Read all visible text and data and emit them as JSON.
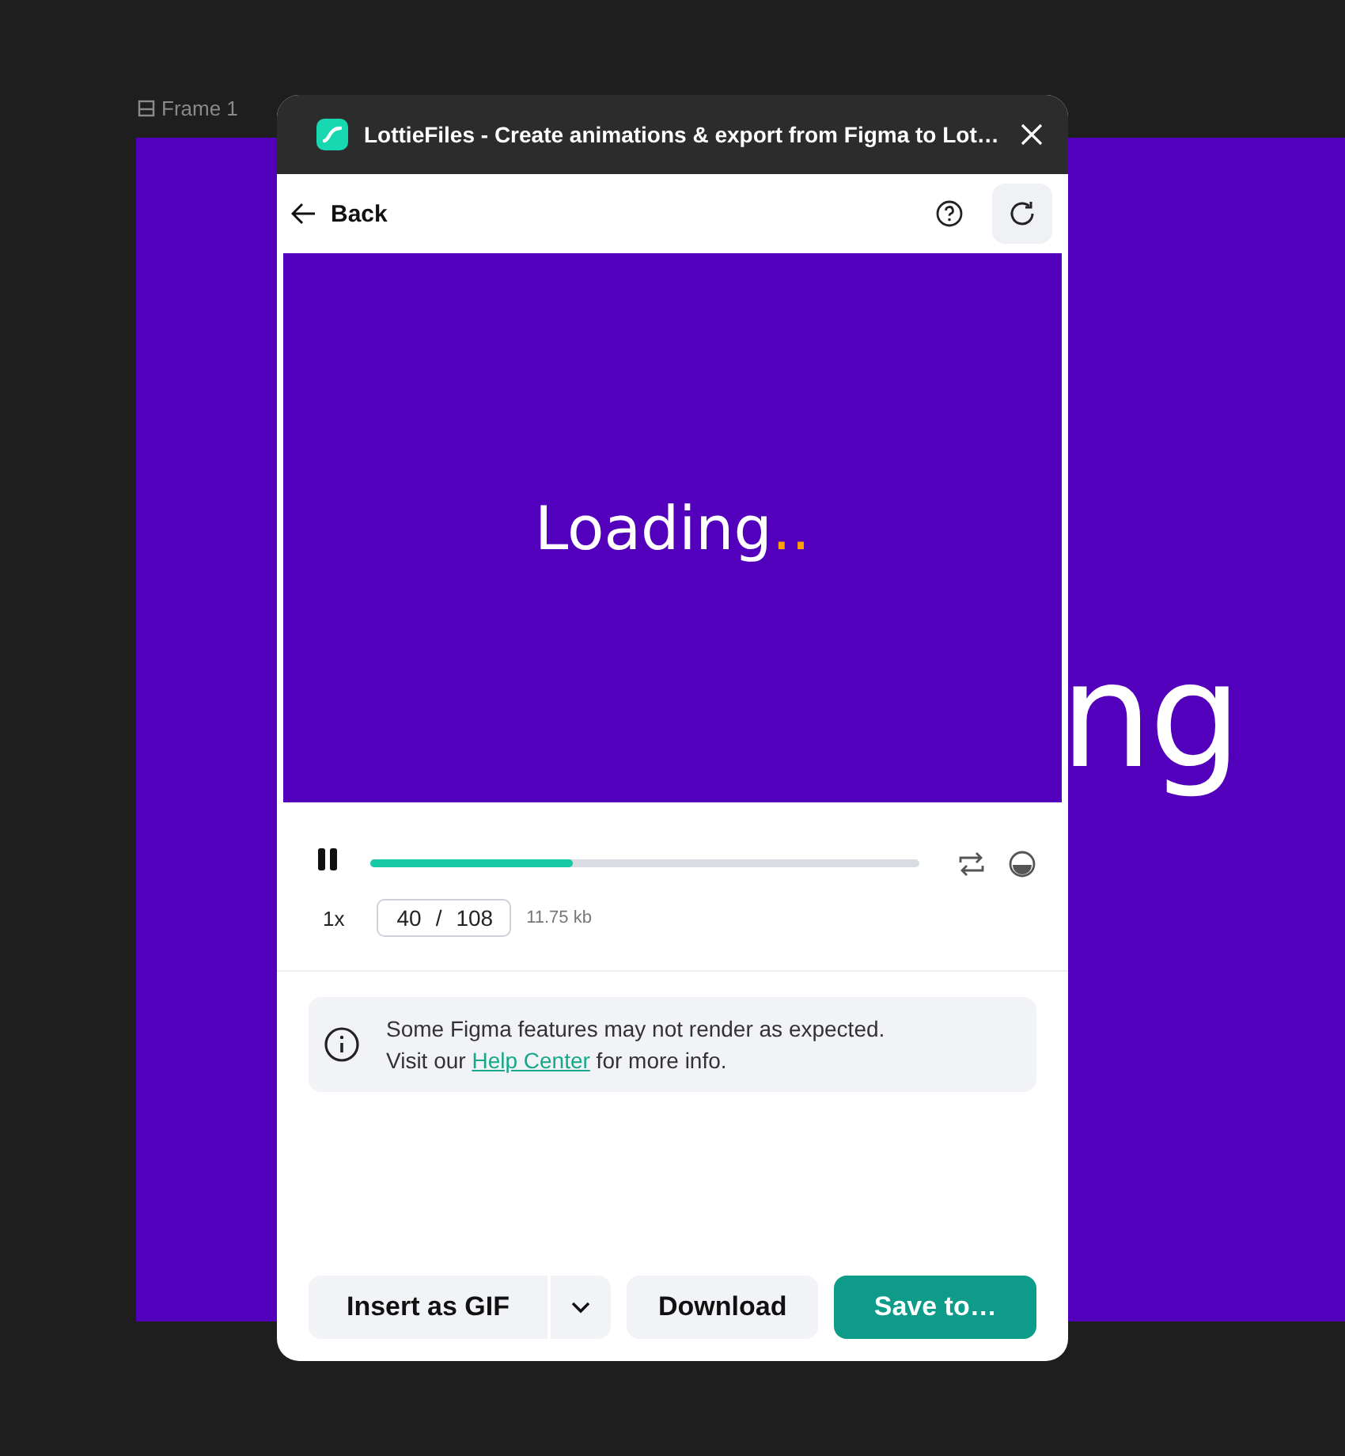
{
  "canvas": {
    "frame_label": "Frame 1",
    "frame_text": "ng"
  },
  "window": {
    "title": "LottieFiles - Create animations & export from Figma to Lot…"
  },
  "header": {
    "back": "Back"
  },
  "preview": {
    "text": "Loading",
    "dots": ".."
  },
  "player": {
    "playing": true,
    "level": 0.37,
    "speed": "1x",
    "frame": {
      "current": "40",
      "separator": "/",
      "total": "108"
    },
    "size": "11.75 kb"
  },
  "notice": {
    "text": "Some Figma features may not render as expected.",
    "before_link": "Visit our",
    "link": "Help Center",
    "after_link": "for more info."
  },
  "buttons": [
    {
      "label": "Insert as GIF",
      "kind": "split"
    },
    {
      "label": "Download",
      "kind": "secondary"
    },
    {
      "label": "Save to…",
      "kind": "primary"
    }
  ]
}
